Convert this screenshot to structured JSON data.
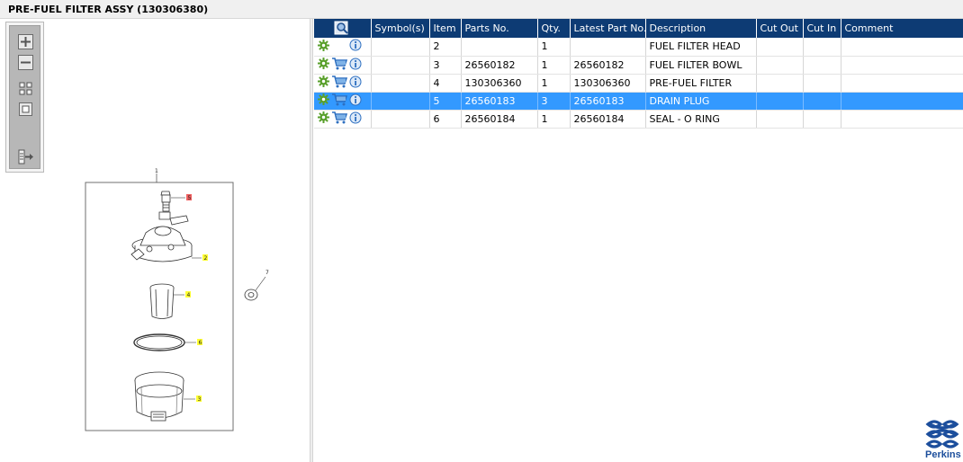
{
  "window": {
    "title": "PRE-FUEL FILTER ASSY (130306380)"
  },
  "toolbox": {
    "zoom_in_icon": "plus-square",
    "zoom_out_icon": "minus-square",
    "fit_icon": "grid-four",
    "actual_size_icon": "square",
    "export_icon": "list-arrow"
  },
  "diagram": {
    "callouts": [
      "1",
      "5",
      "2",
      "4",
      "6",
      "3",
      "7"
    ]
  },
  "table": {
    "columns": [
      "",
      "Symbol(s)",
      "Item",
      "Parts No.",
      "Qty.",
      "Latest Part No.",
      "Description",
      "Cut Out",
      "Cut In",
      "Comment"
    ],
    "rows": [
      {
        "item": "2",
        "parts_no": "",
        "qty": "1",
        "latest": "",
        "description": "FUEL FILTER HEAD",
        "cart": false,
        "selected": false
      },
      {
        "item": "3",
        "parts_no": "26560182",
        "qty": "1",
        "latest": "26560182",
        "description": "FUEL FILTER BOWL",
        "cart": true,
        "selected": false
      },
      {
        "item": "4",
        "parts_no": "130306360",
        "qty": "1",
        "latest": "130306360",
        "description": "PRE-FUEL FILTER",
        "cart": true,
        "selected": false
      },
      {
        "item": "5",
        "parts_no": "26560183",
        "qty": "3",
        "latest": "26560183",
        "description": "DRAIN PLUG",
        "cart": true,
        "selected": true
      },
      {
        "item": "6",
        "parts_no": "26560184",
        "qty": "1",
        "latest": "26560184",
        "description": "SEAL - O RING",
        "cart": true,
        "selected": false
      }
    ]
  },
  "brand": {
    "name": "Perkins",
    "color": "#1c4e9c"
  },
  "colors": {
    "header": "#0d3b74",
    "selected_row": "#3399ff",
    "gear": "#5aa02c",
    "info": "#2d6fc0"
  }
}
